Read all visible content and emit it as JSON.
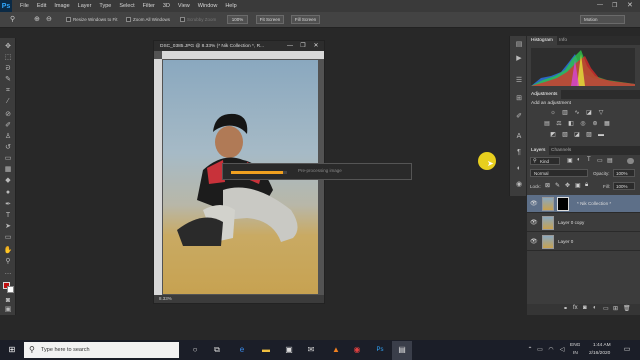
{
  "menubar": {
    "logo": "Ps",
    "items": [
      "File",
      "Edit",
      "Image",
      "Layer",
      "Type",
      "Select",
      "Filter",
      "3D",
      "View",
      "Window",
      "Help"
    ]
  },
  "options": {
    "resize_windows_label": "Resize Windows to Fit",
    "zoom_all_label": "Zoom All Windows",
    "scrubby_label": "Scrubby Zoom",
    "zoom_value": "100%",
    "fit_screen": "Fit Screen",
    "fill_screen": "Fill Screen",
    "workspace": "Motion"
  },
  "document": {
    "title": "DSC_0385.JPG @ 8.33% (* Nik Collection *, R...",
    "zoom_status": "8.33%"
  },
  "progress": {
    "label": "Pre-processing image",
    "fraction": 0.93
  },
  "histogram": {
    "tabs": [
      "Histogram",
      "Info"
    ]
  },
  "adjustments": {
    "tab": "Adjustments",
    "heading": "Add an adjustment"
  },
  "layers": {
    "tabs": [
      "Layers",
      "Channels"
    ],
    "kind": "Kind",
    "blend_mode": "Normal",
    "opacity_label": "Opacity:",
    "opacity_value": "100%",
    "lock_label": "Lock:",
    "fill_label": "Fill:",
    "fill_value": "100%",
    "items": [
      {
        "name": "* Nik Collection *"
      },
      {
        "name": "Layer 0 copy"
      },
      {
        "name": "Layer 0"
      }
    ]
  },
  "taskbar": {
    "search_placeholder": "Type here to search",
    "lang_1": "ENG",
    "lang_2": "IN",
    "time": "1:44 AM",
    "date": "2/16/2020"
  },
  "colors": {
    "accent_progress": "#f0a020",
    "selected_layer": "#5d6f88",
    "cursor_highlight": "#e8cf1e"
  }
}
